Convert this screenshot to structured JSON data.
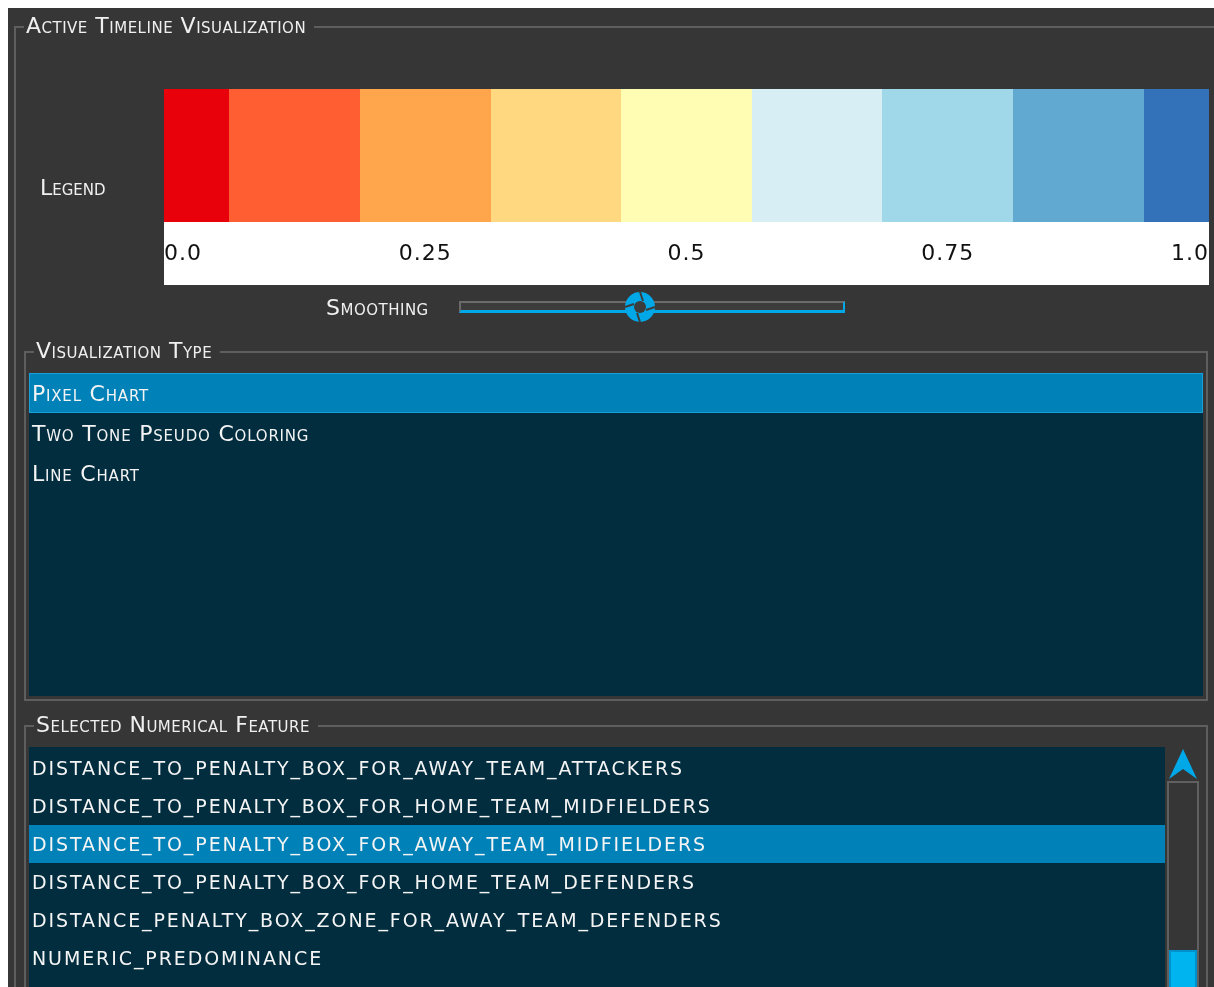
{
  "panel": {
    "title": "Active Timeline Visualization",
    "legend": {
      "label": "Legend",
      "colors": [
        {
          "color": "#e8000b"
        },
        {
          "color": "#ff5e33"
        },
        {
          "color": "#ffa54c"
        },
        {
          "color": "#ffd880"
        },
        {
          "color": "#fffdb4"
        },
        {
          "color": "#d7eff4"
        },
        {
          "color": "#a0d8e9"
        },
        {
          "color": "#62a9d2"
        },
        {
          "color": "#3371b8"
        }
      ],
      "ticks": [
        "0.0",
        "0.25",
        "0.5",
        "0.75",
        "1.0"
      ]
    },
    "smoothing": {
      "label": "Smoothing",
      "level": 0.47
    }
  },
  "visualization_type": {
    "title": "Visualization Type",
    "items": [
      {
        "label": "Pixel Chart",
        "selected": true
      },
      {
        "label": "Two Tone Pseudo Coloring",
        "selected": false
      },
      {
        "label": "Line Chart",
        "selected": false
      }
    ]
  },
  "numerical_feature": {
    "title": "Selected Numerical Feature",
    "items": [
      {
        "label": "DISTANCE_TO_PENALTY_BOX_FOR_AWAY_TEAM_ATTACKERS",
        "selected": false
      },
      {
        "label": "DISTANCE_TO_PENALTY_BOX_FOR_HOME_TEAM_MIDFIELDERS",
        "selected": false
      },
      {
        "label": "DISTANCE_TO_PENALTY_BOX_FOR_AWAY_TEAM_MIDFIELDERS",
        "selected": true
      },
      {
        "label": "DISTANCE_TO_PENALTY_BOX_FOR_HOME_TEAM_DEFENDERS",
        "selected": false
      },
      {
        "label": "DISTANCE_PENALTY_BOX_ZONE_FOR_AWAY_TEAM_DEFENDERS",
        "selected": false
      },
      {
        "label": "NUMERIC_PREDOMINANCE",
        "selected": false
      }
    ]
  }
}
